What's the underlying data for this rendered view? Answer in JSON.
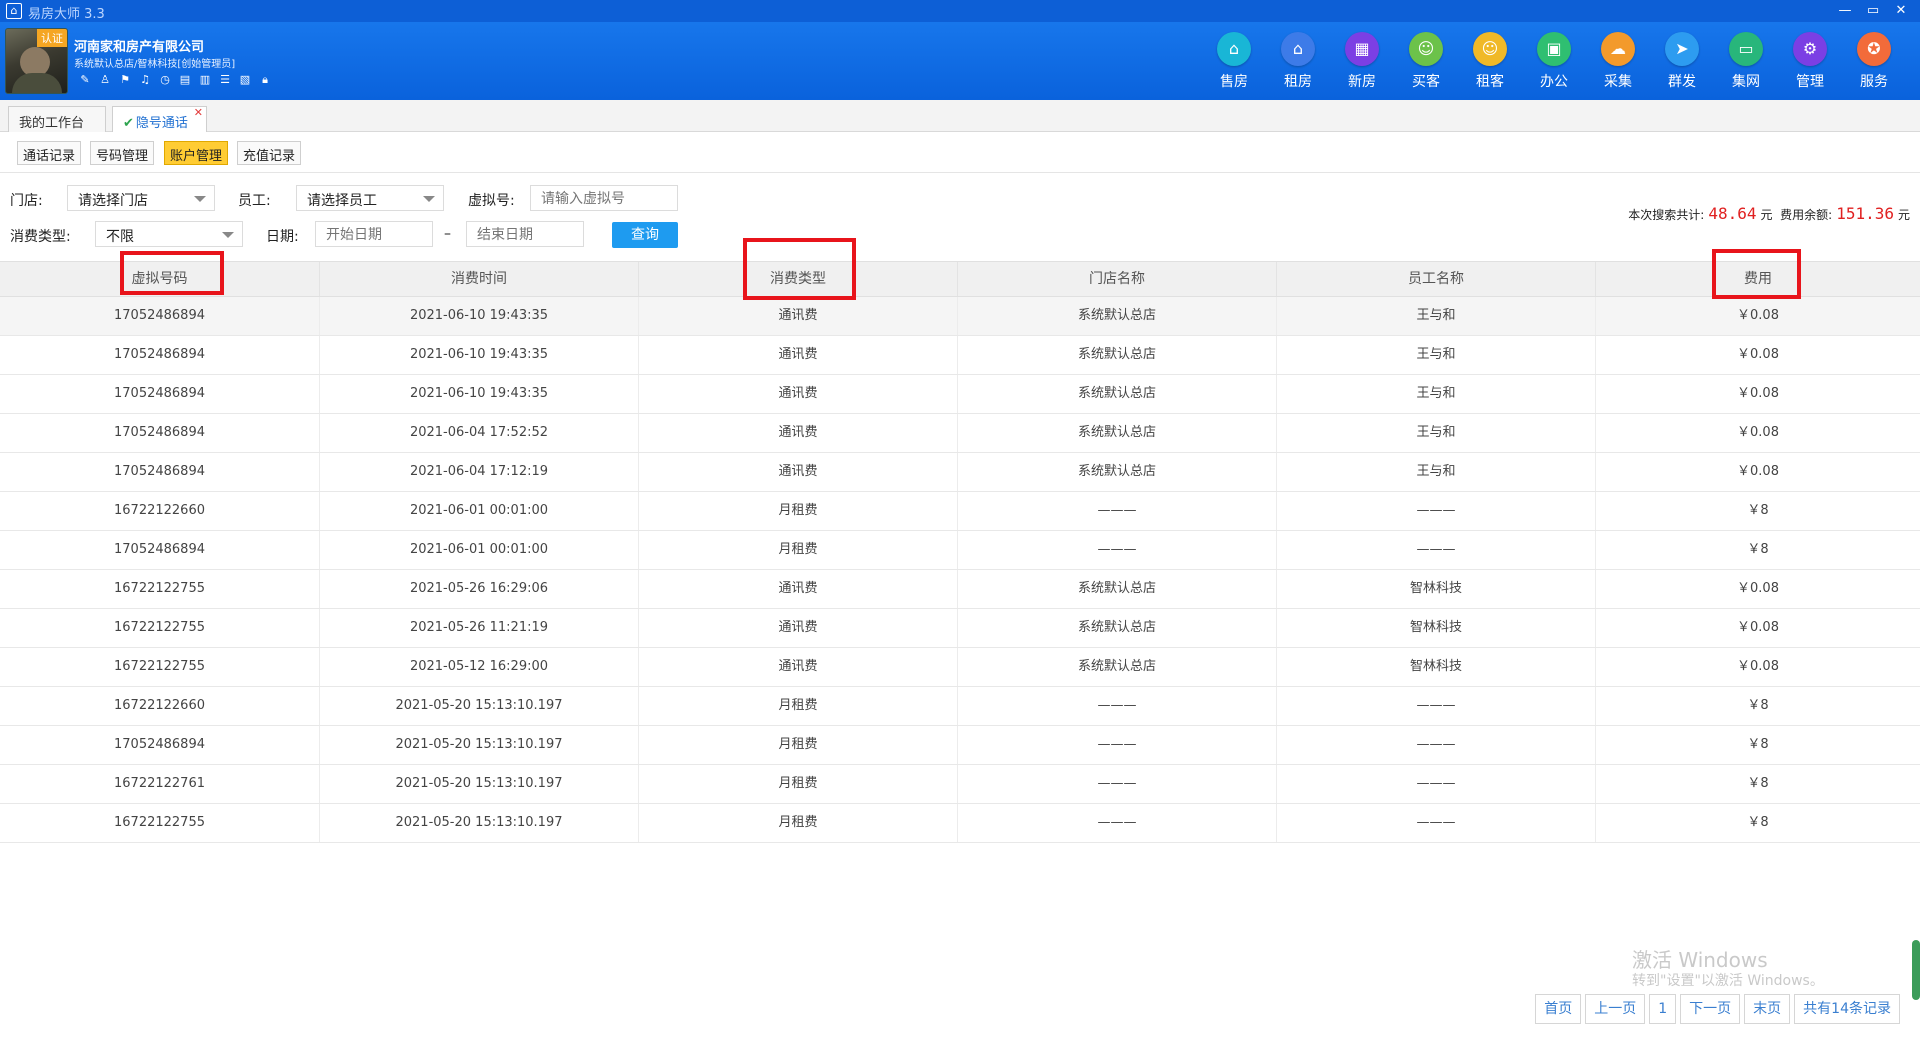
{
  "window": {
    "title": "易房大师 3.3",
    "icon": "home-icon",
    "controls": [
      "minimize-icon",
      "restore-icon",
      "close-icon"
    ]
  },
  "user": {
    "badge": "认证",
    "company": "河南家和房产有限公司",
    "subtitle": "系统默认总店/智林科技[创始管理员]",
    "quick_icons": [
      "pen-icon",
      "shirt-icon",
      "flag-icon",
      "bell-icon",
      "clock-icon",
      "clipboard-icon",
      "file-icon",
      "list-icon",
      "card-icon",
      "lock-icon"
    ]
  },
  "nav": [
    {
      "label": "售房",
      "icon": "house-icon",
      "color": "#19b6d6"
    },
    {
      "label": "租房",
      "icon": "rent-house-icon",
      "color": "#3d7be8"
    },
    {
      "label": "新房",
      "icon": "building-icon",
      "color": "#7c3fe4"
    },
    {
      "label": "买客",
      "icon": "buyer-icon",
      "color": "#6cc24a"
    },
    {
      "label": "租客",
      "icon": "tenant-icon",
      "color": "#f0b928"
    },
    {
      "label": "办公",
      "icon": "printer-icon",
      "color": "#2fbf71"
    },
    {
      "label": "采集",
      "icon": "cloud-download-icon",
      "color": "#f39a2b"
    },
    {
      "label": "群发",
      "icon": "send-icon",
      "color": "#2d9cf0"
    },
    {
      "label": "集网",
      "icon": "monitor-icon",
      "color": "#28b67b"
    },
    {
      "label": "管理",
      "icon": "gear-icon",
      "color": "#7b3fe4"
    },
    {
      "label": "服务",
      "icon": "service-icon",
      "color": "#f26b3a"
    }
  ],
  "tabs": [
    {
      "label": "我的工作台",
      "active": false
    },
    {
      "label": "隐号通话",
      "active": true
    }
  ],
  "subtabs": [
    {
      "label": "通话记录",
      "active": false
    },
    {
      "label": "号码管理",
      "active": false
    },
    {
      "label": "账户管理",
      "active": true
    },
    {
      "label": "充值记录",
      "active": false
    }
  ],
  "filters": {
    "store_label": "门店:",
    "store_value": "请选择门店",
    "staff_label": "员工:",
    "staff_value": "请选择员工",
    "vnum_label": "虚拟号:",
    "vnum_placeholder": "请输入虚拟号",
    "type_label": "消费类型:",
    "type_value": "不限",
    "date_label": "日期:",
    "date_start_placeholder": "开始日期",
    "date_sep": "–",
    "date_end_placeholder": "结束日期",
    "query_label": "查询"
  },
  "summary": {
    "total_label": "本次搜索共计:",
    "total_value": "48.64",
    "unit1": "元",
    "balance_label": "费用余额:",
    "balance_value": "151.36",
    "unit2": "元"
  },
  "table": {
    "columns": [
      "虚拟号码",
      "消费时间",
      "消费类型",
      "门店名称",
      "员工名称",
      "费用"
    ],
    "rows": [
      [
        "17052486894",
        "2021-06-10 19:43:35",
        "通讯费",
        "系统默认总店",
        "王与和",
        "￥0.08"
      ],
      [
        "17052486894",
        "2021-06-10 19:43:35",
        "通讯费",
        "系统默认总店",
        "王与和",
        "￥0.08"
      ],
      [
        "17052486894",
        "2021-06-10 19:43:35",
        "通讯费",
        "系统默认总店",
        "王与和",
        "￥0.08"
      ],
      [
        "17052486894",
        "2021-06-04 17:52:52",
        "通讯费",
        "系统默认总店",
        "王与和",
        "￥0.08"
      ],
      [
        "17052486894",
        "2021-06-04 17:12:19",
        "通讯费",
        "系统默认总店",
        "王与和",
        "￥0.08"
      ],
      [
        "16722122660",
        "2021-06-01 00:01:00",
        "月租费",
        "———",
        "———",
        "￥8"
      ],
      [
        "17052486894",
        "2021-06-01 00:01:00",
        "月租费",
        "———",
        "———",
        "￥8"
      ],
      [
        "16722122755",
        "2021-05-26 16:29:06",
        "通讯费",
        "系统默认总店",
        "智林科技",
        "￥0.08"
      ],
      [
        "16722122755",
        "2021-05-26 11:21:19",
        "通讯费",
        "系统默认总店",
        "智林科技",
        "￥0.08"
      ],
      [
        "16722122755",
        "2021-05-12 16:29:00",
        "通讯费",
        "系统默认总店",
        "智林科技",
        "￥0.08"
      ],
      [
        "16722122660",
        "2021-05-20 15:13:10.197",
        "月租费",
        "———",
        "———",
        "￥8"
      ],
      [
        "17052486894",
        "2021-05-20 15:13:10.197",
        "月租费",
        "———",
        "———",
        "￥8"
      ],
      [
        "16722122761",
        "2021-05-20 15:13:10.197",
        "月租费",
        "———",
        "———",
        "￥8"
      ],
      [
        "16722122755",
        "2021-05-20 15:13:10.197",
        "月租费",
        "———",
        "———",
        "￥8"
      ]
    ]
  },
  "watermark": {
    "line1": "激活 Windows",
    "line2": "转到\"设置\"以激活 Windows。"
  },
  "pager": {
    "first": "首页",
    "prev": "上一页",
    "page": "1",
    "next": "下一页",
    "last": "末页",
    "total": "共有14条记录"
  },
  "colors": {
    "header_blue": "#0a62dc",
    "highlight_red": "#e8141b",
    "query_blue": "#1e9bf0",
    "active_tab_yellow": "#ffcc33",
    "amount_red": "#e02020"
  }
}
